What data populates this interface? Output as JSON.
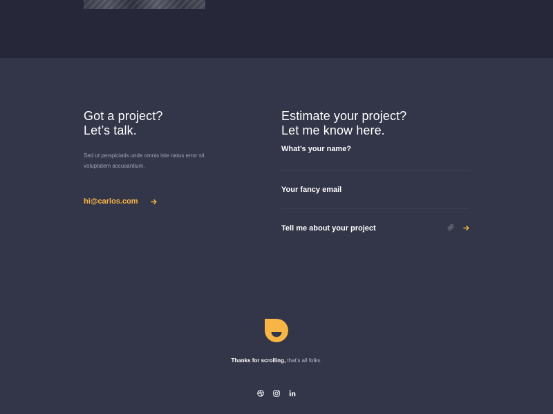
{
  "contact": {
    "heading_line1": "Got a project?",
    "heading_line2": "Let’s talk.",
    "description": "Sed ut perspiciatis unde omnis iste natus error sit voluptatem accusantium.",
    "email": "hi@carlos.com"
  },
  "form": {
    "heading_line1": "Estimate your project?",
    "heading_line2": "Let me know here.",
    "name_label": "What’s your name?",
    "email_label": "Your fancy email",
    "project_label": "Tell me about your project"
  },
  "footer": {
    "thanks_bold": "Thanks for scrolling,",
    "thanks_rest": " that’s all folks.",
    "socials": [
      "dribbble-icon",
      "instagram-icon",
      "linkedin-icon"
    ]
  },
  "colors": {
    "accent": "#f7b545",
    "background": "#333548",
    "top_band": "#26283a"
  }
}
